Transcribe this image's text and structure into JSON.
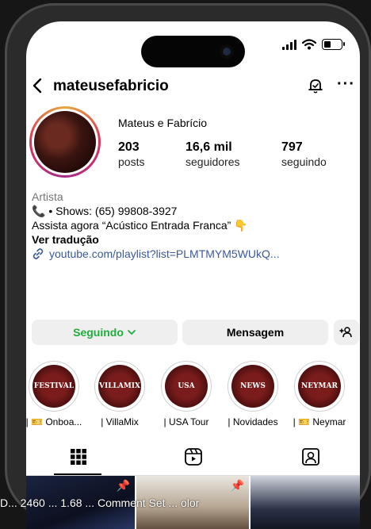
{
  "profile": {
    "username": "mateusefabricio",
    "full_name": "Mateus e Fabrício",
    "stats": [
      {
        "value": "203",
        "label": "posts"
      },
      {
        "value": "16,6 mil",
        "label": "seguidores"
      },
      {
        "value": "797",
        "label": "seguindo"
      }
    ],
    "category": "Artista",
    "bio_shows": "• Shows: (65) 99808-3927",
    "bio_line2": "Assista agora “Acústico Entrada Franca”",
    "see_translation": "Ver tradução",
    "link": "youtube.com/playlist?list=PLMTMYM5WUkQ..."
  },
  "buttons": {
    "following": "Seguindo",
    "message": "Mensagem"
  },
  "highlights": [
    {
      "caption": "| 🎫 Onboa...",
      "badge": "FESTIVAL"
    },
    {
      "caption": "| VillaMix",
      "badge": "VILLAMIX"
    },
    {
      "caption": "| USA Tour",
      "badge": "USA"
    },
    {
      "caption": "| Novidades",
      "badge": "NEWS"
    },
    {
      "caption": "| 🎫 Neymar",
      "badge": "NEYMAR"
    }
  ],
  "icons": {
    "back": "chevron-left-icon",
    "notifications": "bell-icon",
    "more": "more-icon",
    "grid_tab": "grid-icon",
    "reels_tab": "reels-icon",
    "tagged_tab": "tagged-icon",
    "add_person": "add-person-icon",
    "link": "link-icon",
    "pin": "pin-icon"
  },
  "colors": {
    "following_text": "#1fae3c",
    "link_text": "#3b5998"
  },
  "overlay_text": "D... 2460 ... 1.68 ... Comment Set ... olor"
}
